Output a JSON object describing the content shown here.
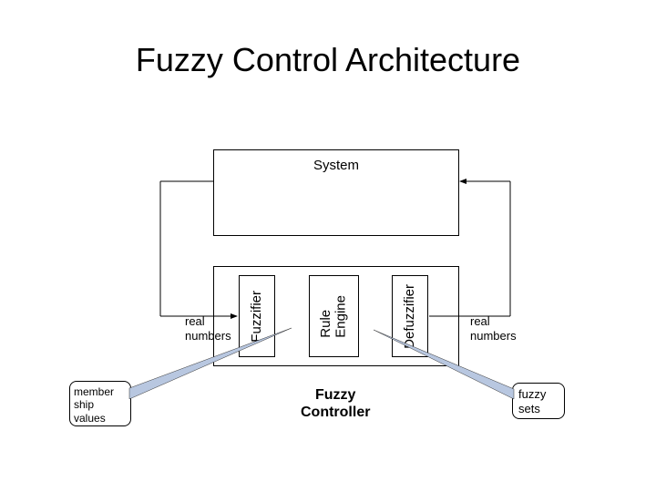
{
  "title": "Fuzzy Control Architecture",
  "system_box": "System",
  "fuzzifier": "Fuzzifier",
  "rule_engine": "Rule\nEngine",
  "defuzzifier": "Defuzzifier",
  "real_numbers_left": "real\nnumbers",
  "real_numbers_right": "real\nnumbers",
  "fuzzy_controller": "Fuzzy\nController",
  "membership_values": "member\nship\nvalues",
  "fuzzy_sets": "fuzzy\nsets"
}
